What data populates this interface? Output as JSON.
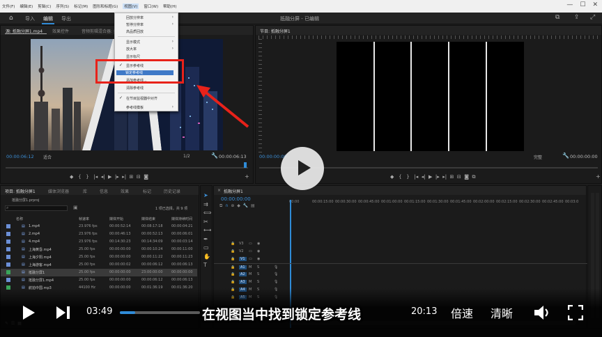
{
  "menubar": {
    "items": [
      "文件(F)",
      "编辑(E)",
      "剪辑(C)",
      "序列(S)",
      "标记(M)",
      "图形和标题(G)",
      "视图(V)",
      "窗口(W)",
      "帮助(H)"
    ]
  },
  "app_header": {
    "tabs": [
      "导入",
      "编辑",
      "导出"
    ],
    "active_tab": "编辑",
    "title": "抵融分屏 - 已编辑"
  },
  "source_monitor": {
    "tabs": [
      "源: 抵融分屏1.mp4",
      "效果控件",
      "音频剪辑混合器: 抵融分屏1"
    ],
    "timecode_in": "00:00:06:12",
    "fit": "适合",
    "ratio": "1/2",
    "timecode_out": "00:00:06:13"
  },
  "view_menu": {
    "items": [
      {
        "label": "回放分辨率",
        "arrow": true,
        "check": false
      },
      {
        "label": "暂停分辨率",
        "arrow": true,
        "check": false
      },
      {
        "label": "高品质回放",
        "arrow": false,
        "check": false
      },
      {
        "label": "显示模式",
        "arrow": true,
        "check": false
      },
      {
        "label": "放大率",
        "arrow": true,
        "check": false
      },
      {
        "label": "显示标尺",
        "arrow": false,
        "check": false
      },
      {
        "label": "显示参考线",
        "arrow": false,
        "check": true
      },
      {
        "label": "锁定参考线",
        "arrow": false,
        "check": false
      },
      {
        "label": "添加参考线...",
        "arrow": false,
        "check": false
      },
      {
        "label": "清除参考线",
        "arrow": false,
        "check": false
      },
      {
        "label": "在节目监视器中对齐",
        "arrow": false,
        "check": true
      },
      {
        "label": "参考线模板",
        "arrow": true,
        "check": false
      }
    ]
  },
  "program_monitor": {
    "tab": "节目: 抵融分屏1",
    "timecode_in": "00:00:00:00",
    "fit": "完整",
    "timecode_out": "00:00:00:00"
  },
  "project_panel": {
    "tabs": [
      "项目: 抵融分屏1",
      "媒体浏览器",
      "库",
      "信息",
      "效果",
      "标记",
      "历史记录"
    ],
    "project_file": "抵融分屏1.prproj",
    "selection_status": "1 项已选择，共 9 项",
    "columns": [
      "名称",
      "帧速率",
      "媒体开始",
      "媒体结束",
      "媒体持续时间"
    ],
    "rows": [
      {
        "name": "1.mp4",
        "fps": "23.976 fps",
        "start": "00:00:52:14",
        "end": "00:08:17:18",
        "dur": "00:00:04:21",
        "color": "#6b8fd6"
      },
      {
        "name": "2.mp4",
        "fps": "23.976 fps",
        "start": "00:00:46:13",
        "end": "00:00:52:13",
        "dur": "00:00:06:01",
        "color": "#6b8fd6"
      },
      {
        "name": "4.mp4",
        "fps": "23.976 fps",
        "start": "00:14:30:23",
        "end": "00:14:34:09",
        "dur": "00:00:03:14",
        "color": "#6b8fd6"
      },
      {
        "name": "上海黄昏.mp4",
        "fps": "25.00 fps",
        "start": "00:00:00:00",
        "end": "00:00:10:24",
        "dur": "00:00:11:00",
        "color": "#6b8fd6"
      },
      {
        "name": "上海夕阳.mp4",
        "fps": "25.00 fps",
        "start": "00:00:00:00",
        "end": "00:00:11:22",
        "dur": "00:00:11:23",
        "color": "#6b8fd6"
      },
      {
        "name": "上海游客.mp4",
        "fps": "25.00 fps",
        "start": "00:00:00:02",
        "end": "00:00:06:12",
        "dur": "00:00:06:13",
        "color": "#6b8fd6"
      },
      {
        "name": "抵融分屏1",
        "fps": "25.00 fps",
        "start": "00:00:00:00",
        "end": "23:00:00:00",
        "dur": "00:00:00:00",
        "color": "#3aa55a"
      },
      {
        "name": "抵融分屏1.mp4",
        "fps": "25.00 fps",
        "start": "00:00:00:00",
        "end": "00:00:06:12",
        "dur": "00:00:06:13",
        "color": "#6b8fd6"
      },
      {
        "name": "航拍中国.mp3",
        "fps": "44100 Hz",
        "start": "00:00:00:00",
        "end": "00:01:36:19",
        "dur": "00:01:36:20",
        "color": "#3aa55a"
      }
    ]
  },
  "timeline": {
    "tab": "抵融分屏1",
    "timecode": "00:00:00:00",
    "ruler": [
      "00:00",
      "00:00:15:00",
      "00:00:30:00",
      "00:00:45:00",
      "00:01:00:00",
      "00:01:15:00",
      "00:01:30:00",
      "00:01:45:00",
      "00:02:00:00",
      "00:02:15:00",
      "00:02:30:00",
      "00:02:45:00",
      "00:03:0"
    ],
    "video_tracks": [
      "V3",
      "V2",
      "V1"
    ],
    "audio_tracks": [
      "A1",
      "A2",
      "A3",
      "A4",
      "A5"
    ]
  },
  "player": {
    "current_time": "03:49",
    "duration": "20:13",
    "progress": 0.19,
    "subtitle": "在视图当中找到锁定参考线",
    "speed_label": "倍速",
    "quality_label": "清晰"
  },
  "colors": {
    "accent": "#2f8bd7",
    "highlight_box": "#e8221a",
    "menu_highlight": "#3f79c7"
  }
}
